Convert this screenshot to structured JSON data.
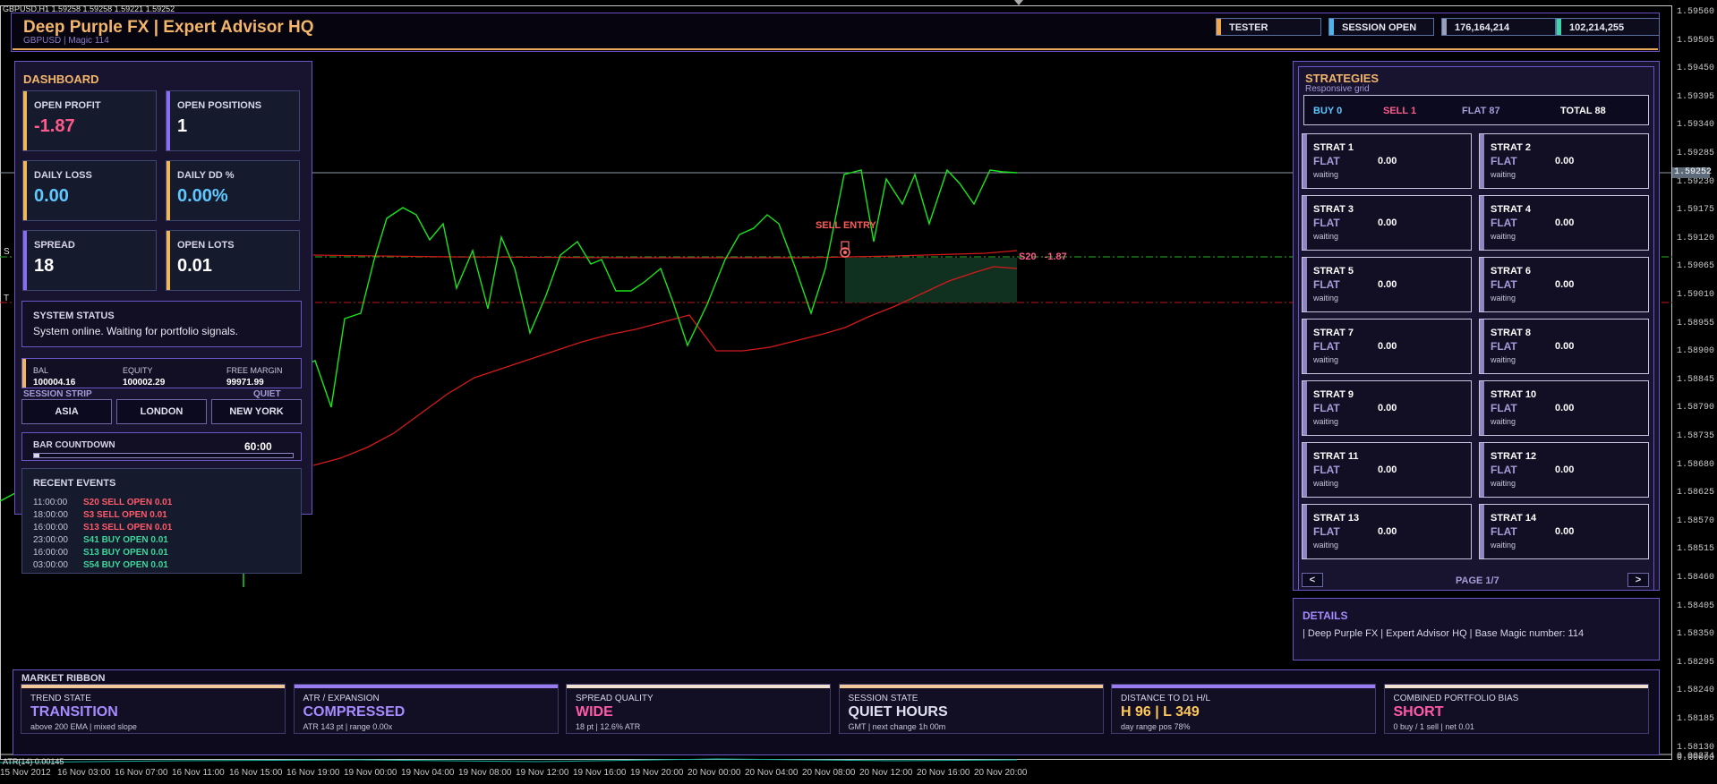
{
  "terminal": {
    "info": "GBPUSD,H1  1.59258 1.59258 1.59221 1.59252",
    "atr_label": "ATR(14) 0.00145"
  },
  "price_axis": [
    "1.59560",
    "1.59505",
    "1.59450",
    "1.59395",
    "1.59340",
    "1.59285",
    "1.59230",
    "1.59175",
    "1.59120",
    "1.59065",
    "1.59010",
    "1.58955",
    "1.58900",
    "1.58845",
    "1.58790",
    "1.58735",
    "1.58680",
    "1.58625",
    "1.58570",
    "1.58515",
    "1.58460",
    "1.58405",
    "1.58350",
    "1.58295",
    "1.58240",
    "1.58185",
    "1.58130"
  ],
  "price_current": "1.59252",
  "atr_axis": [
    "0.00274",
    "0.00000"
  ],
  "time_axis": [
    "15 Nov 2012",
    "16 Nov 03:00",
    "16 Nov 07:00",
    "16 Nov 11:00",
    "16 Nov 15:00",
    "16 Nov 19:00",
    "19 Nov 00:00",
    "19 Nov 04:00",
    "19 Nov 08:00",
    "19 Nov 12:00",
    "19 Nov 16:00",
    "19 Nov 20:00",
    "20 Nov 00:00",
    "20 Nov 04:00",
    "20 Nov 08:00",
    "20 Nov 12:00",
    "20 Nov 16:00",
    "20 Nov 20:00"
  ],
  "chart_marks": {
    "sell_entry": "SELL ENTRY",
    "position_tag": "S20 -1.87",
    "left_tag_1": "S",
    "left_tag_2": "T"
  },
  "header": {
    "title": "Deep Purple FX | Expert Advisor HQ",
    "subtitle": "GBPUSD  |  Magic 114",
    "chips": [
      {
        "label": "TESTER",
        "color": "#f0a64a"
      },
      {
        "label": "SESSION OPEN",
        "color": "#4fb4e8"
      },
      {
        "label": "176,164,214",
        "color": "#9aa0b8"
      },
      {
        "label": "102,214,255",
        "color": "#3ed6a6"
      }
    ]
  },
  "dashboard": {
    "title": "DASHBOARD",
    "cards": [
      {
        "label": "OPEN PROFIT",
        "value": "-1.87",
        "bar": "#f0b65c",
        "value_color": "#ff5a8c"
      },
      {
        "label": "OPEN POSITIONS",
        "value": "1",
        "bar": "#8a6cf0",
        "value_color": "#ffffff"
      },
      {
        "label": "DAILY LOSS",
        "value": "0.00",
        "bar": "#f0b65c",
        "value_color": "#5fc8ff"
      },
      {
        "label": "DAILY DD %",
        "value": "0.00%",
        "bar": "#f0b65c",
        "value_color": "#5fc8ff"
      },
      {
        "label": "SPREAD",
        "value": "18",
        "bar": "#8a6cf0",
        "value_color": "#ffffff"
      },
      {
        "label": "OPEN LOTS",
        "value": "0.01",
        "bar": "#f0b65c",
        "value_color": "#ffffff"
      }
    ],
    "system_status_label": "SYSTEM STATUS",
    "system_status_text": "System online. Waiting for portfolio signals.",
    "account": {
      "bal_label": "BAL",
      "bal": "100004.16",
      "equity_label": "EQUITY",
      "equity": "100002.29",
      "margin_label": "FREE MARGIN",
      "margin": "99971.99"
    },
    "session_strip_label": "SESSION STRIP",
    "session_state": "QUIET",
    "sessions": [
      "ASIA",
      "LONDON",
      "NEW YORK"
    ],
    "countdown_label": "BAR COUNTDOWN",
    "countdown_value": "60:00",
    "countdown_fraction": 0.02,
    "events_title": "RECENT EVENTS",
    "events": [
      {
        "time": "11:00:00",
        "text": "S20 SELL OPEN 0.01",
        "color": "#ff5a6a"
      },
      {
        "time": "18:00:00",
        "text": "S3 SELL OPEN 0.01",
        "color": "#ff5a6a"
      },
      {
        "time": "16:00:00",
        "text": "S13 SELL OPEN 0.01",
        "color": "#ff5a6a"
      },
      {
        "time": "23:00:00",
        "text": "S41 BUY OPEN 0.01",
        "color": "#3ed69a"
      },
      {
        "time": "16:00:00",
        "text": "S13 BUY OPEN 0.01",
        "color": "#3ed69a"
      },
      {
        "time": "03:00:00",
        "text": "S54 BUY OPEN 0.01",
        "color": "#3ed69a"
      }
    ]
  },
  "strategies": {
    "title": "STRATEGIES",
    "subtitle": "Responsive grid",
    "summary": {
      "buy": "BUY 0",
      "sell": "SELL 1",
      "flat": "FLAT 87",
      "total": "TOTAL 88"
    },
    "items": [
      {
        "name": "STRAT 1",
        "state": "FLAT",
        "value": "0.00",
        "status": "waiting"
      },
      {
        "name": "STRAT 2",
        "state": "FLAT",
        "value": "0.00",
        "status": "waiting"
      },
      {
        "name": "STRAT 3",
        "state": "FLAT",
        "value": "0.00",
        "status": "waiting"
      },
      {
        "name": "STRAT 4",
        "state": "FLAT",
        "value": "0.00",
        "status": "waiting"
      },
      {
        "name": "STRAT 5",
        "state": "FLAT",
        "value": "0.00",
        "status": "waiting"
      },
      {
        "name": "STRAT 6",
        "state": "FLAT",
        "value": "0.00",
        "status": "waiting"
      },
      {
        "name": "STRAT 7",
        "state": "FLAT",
        "value": "0.00",
        "status": "waiting"
      },
      {
        "name": "STRAT 8",
        "state": "FLAT",
        "value": "0.00",
        "status": "waiting"
      },
      {
        "name": "STRAT 9",
        "state": "FLAT",
        "value": "0.00",
        "status": "waiting"
      },
      {
        "name": "STRAT 10",
        "state": "FLAT",
        "value": "0.00",
        "status": "waiting"
      },
      {
        "name": "STRAT 11",
        "state": "FLAT",
        "value": "0.00",
        "status": "waiting"
      },
      {
        "name": "STRAT 12",
        "state": "FLAT",
        "value": "0.00",
        "status": "waiting"
      },
      {
        "name": "STRAT 13",
        "state": "FLAT",
        "value": "0.00",
        "status": "waiting"
      },
      {
        "name": "STRAT 14",
        "state": "FLAT",
        "value": "0.00",
        "status": "waiting"
      }
    ],
    "prev": "<",
    "next": ">",
    "page": "PAGE 1/7"
  },
  "details": {
    "title": "DETAILS",
    "text": " | Deep Purple FX | Expert Advisor HQ | Base Magic number: 114"
  },
  "ribbon": {
    "title": "MARKET RIBBON",
    "cards": [
      {
        "label": "TREND STATE",
        "value": "TRANSITION",
        "sub": "above 200 EMA | mixed slope",
        "top": "#f0c89a",
        "value_color": "#a58cff"
      },
      {
        "label": "ATR / EXPANSION",
        "value": "COMPRESSED",
        "sub": "ATR 143 pt | range 0.00x",
        "top": "#9a7cf0",
        "value_color": "#a58cff"
      },
      {
        "label": "SPREAD QUALITY",
        "value": "WIDE",
        "sub": "18 pt | 12.6% ATR",
        "top": "#f0e0d0",
        "value_color": "#ff5aa8"
      },
      {
        "label": "SESSION STATE",
        "value": "QUIET HOURS",
        "sub": "GMT | next change 1h 00m",
        "top": "#f0c89a",
        "value_color": "#e0e0f0"
      },
      {
        "label": "DISTANCE TO D1 H/L",
        "value": "H 96 | L 349",
        "sub": "day range pos 78%",
        "top": "#9a7cf0",
        "value_color": "#ffc85a"
      },
      {
        "label": "COMBINED PORTFOLIO BIAS",
        "value": "SHORT",
        "sub": "0 buy / 1 sell | net 0.01",
        "top": "#f0e0d0",
        "value_color": "#ff5aa8"
      }
    ]
  }
}
